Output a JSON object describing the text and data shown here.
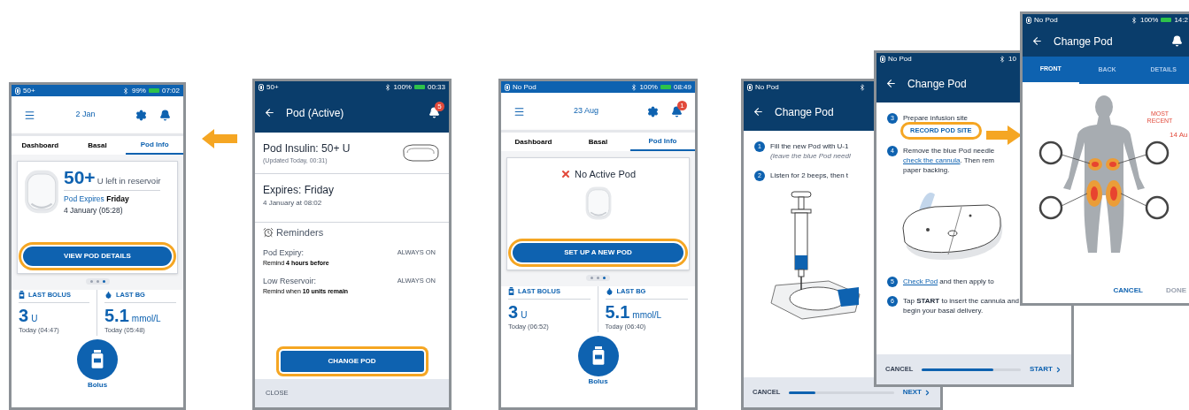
{
  "screens": [
    {
      "kind": "dashboard",
      "status": {
        "left": "50+",
        "battery": "99%",
        "time": "07:02"
      },
      "date": "2 Jan",
      "tabs": [
        {
          "label": "Dashboard",
          "selected": false
        },
        {
          "label": "Basal",
          "selected": false
        },
        {
          "label": "Pod Info",
          "selected": true
        }
      ],
      "card": {
        "kind": "active",
        "amount": "50+",
        "amount_unit": "U left in reservoir",
        "expires": "Pod Expires **Friday**",
        "expires_date": "4 January (05:28)",
        "button": {
          "label": "VIEW POD DETAILS",
          "highlighted": true
        }
      },
      "pager": [
        {
          "selected": false
        },
        {
          "selected": false
        },
        {
          "selected": true
        }
      ],
      "last_bolus": {
        "label": "LAST BOLUS",
        "value": "3",
        "unit": "U",
        "time": "Today (04:47)"
      },
      "last_bg": {
        "label": "LAST BG",
        "value": "5.1",
        "unit": "mmol/L",
        "time": "Today (05:48)"
      },
      "bolus_label": "Bolus"
    },
    {
      "kind": "pod_detail",
      "status": {
        "left": "50+",
        "battery": "100%",
        "time": "00:33"
      },
      "title": "Pod (Active)",
      "bell_badge": "5",
      "insulin": "Pod Insulin: 50+ U",
      "updated": "(Updated Today, 00:31)",
      "expires": "Expires: Friday",
      "expires_date": "4 January at 08:02",
      "reminders_title": "Reminders",
      "reminders": [
        {
          "name": "Pod Expiry:",
          "state": "ALWAYS ON",
          "detail": "Remind **4 hours before**"
        },
        {
          "name": "Low Reservoir:",
          "state": "ALWAYS ON",
          "detail": "Remind when **10 units remain**"
        }
      ],
      "button": {
        "label": "CHANGE POD",
        "highlighted": true
      },
      "footer": "CLOSE"
    },
    {
      "kind": "dashboard",
      "status": {
        "left": "No Pod",
        "battery": "100%",
        "time": "08:49"
      },
      "date": "23 Aug",
      "bell_badge": "1",
      "tabs": [
        {
          "label": "Dashboard",
          "selected": false
        },
        {
          "label": "Basal",
          "selected": false
        },
        {
          "label": "Pod Info",
          "selected": true
        }
      ],
      "card": {
        "kind": "none",
        "message": "No Active Pod",
        "button": {
          "label": "SET UP A NEW POD",
          "highlighted": true
        }
      },
      "pager": [
        {
          "selected": false
        },
        {
          "selected": false
        },
        {
          "selected": true
        }
      ],
      "last_bolus": {
        "label": "LAST BOLUS",
        "value": "3",
        "unit": "U",
        "time": "Today (06:52)"
      },
      "last_bg": {
        "label": "LAST BG",
        "value": "5.1",
        "unit": "mmol/L",
        "time": "Today (06:40)"
      },
      "bolus_label": "Bolus"
    },
    {
      "kind": "steps",
      "status": {
        "left": "No Pod"
      },
      "title": "Change Pod",
      "steps": [
        {
          "number": "1",
          "lines": [
            [
              {
                "kind": "text",
                "text": "Fill the new Pod with U-1"
              }
            ]
          ],
          "note": "(leave the blue Pod needl"
        },
        {
          "number": "2",
          "lines": [
            [
              {
                "kind": "text",
                "text": "Listen for 2 beeps, then t"
              }
            ]
          ],
          "figure": {
            "kind": "syringe"
          }
        }
      ],
      "footer": {
        "cancel": "CANCEL",
        "level": 0.25,
        "next": "NEXT"
      }
    },
    {
      "kind": "steps",
      "status": {
        "left": "No Pod",
        "battery": "10"
      },
      "title": "Change Pod",
      "steps": [
        {
          "number": "3",
          "lines": [
            [
              {
                "kind": "text",
                "text": "Prepare infusion site"
              }
            ]
          ],
          "action": {
            "label": "RECORD POD SITE",
            "highlighted": true
          }
        },
        {
          "number": "4",
          "lines": [
            [
              {
                "kind": "text",
                "text": "Remove the blue Pod needle"
              }
            ],
            [
              {
                "kind": "link",
                "text": "check the cannula"
              },
              {
                "kind": "text",
                "text": ". Then rem"
              }
            ],
            [
              {
                "kind": "text",
                "text": "paper backing."
              }
            ]
          ],
          "figure": {
            "kind": "pod"
          }
        },
        {
          "number": "5",
          "lines": [
            [
              {
                "kind": "link",
                "text": "Check Pod"
              },
              {
                "kind": "text",
                "text": " and then apply to"
              }
            ]
          ]
        },
        {
          "number": "6",
          "lines": [
            [
              {
                "kind": "text",
                "text": "Tap **START** to insert the cannula and"
              }
            ],
            [
              {
                "kind": "text",
                "text": "begin your basal delivery."
              }
            ]
          ]
        }
      ],
      "footer": {
        "cancel": "CANCEL",
        "level": 0.72,
        "next": "START"
      }
    },
    {
      "kind": "site",
      "status": {
        "left": "No Pod",
        "battery": "100%",
        "time": "14:2"
      },
      "title": "Change Pod",
      "tabs": [
        {
          "label": "FRONT",
          "selected": true
        },
        {
          "label": "BACK",
          "selected": false
        },
        {
          "label": "DETAILS",
          "selected": false
        }
      ],
      "recent_label": "MOST RECENT",
      "recent_date": "14 Au",
      "actions": [
        {
          "label": "CANCEL",
          "disabled": false
        },
        {
          "label": "DONE",
          "disabled": true
        }
      ]
    }
  ]
}
